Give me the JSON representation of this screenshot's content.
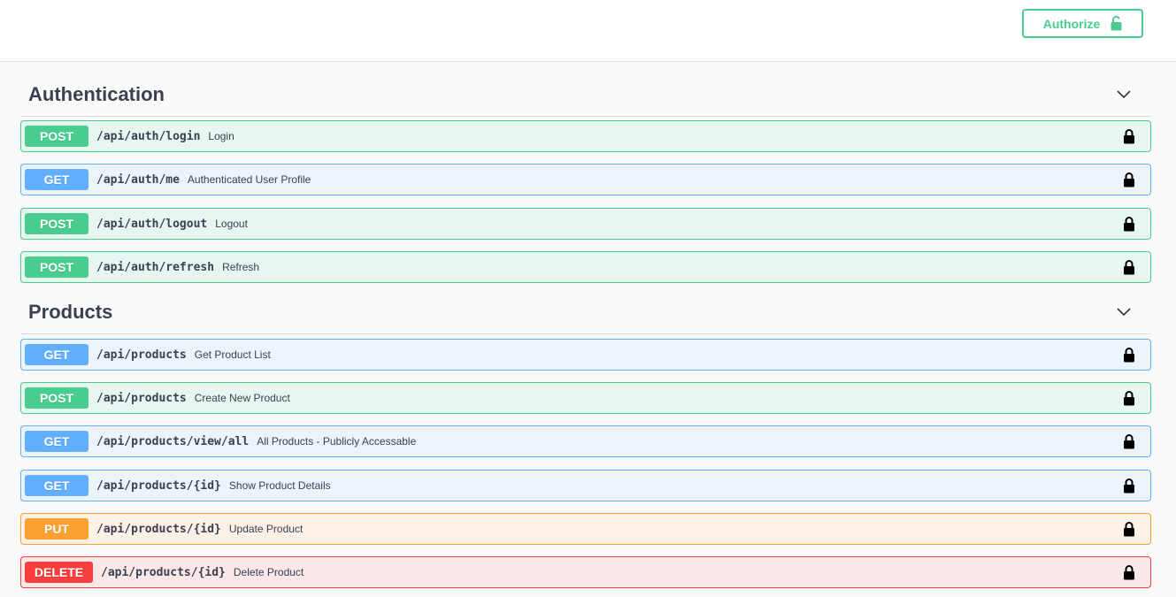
{
  "header": {
    "authorize_label": "Authorize",
    "authorize_icon": "unlocked-lock-icon"
  },
  "colors": {
    "post": "#49cc90",
    "get": "#61affe",
    "put": "#fca130",
    "delete": "#f93e3e"
  },
  "sections": [
    {
      "title": "Authentication",
      "operations": [
        {
          "method": "POST",
          "path": "/api/auth/login",
          "summary": "Login"
        },
        {
          "method": "GET",
          "path": "/api/auth/me",
          "summary": "Authenticated User Profile"
        },
        {
          "method": "POST",
          "path": "/api/auth/logout",
          "summary": "Logout"
        },
        {
          "method": "POST",
          "path": "/api/auth/refresh",
          "summary": "Refresh"
        }
      ]
    },
    {
      "title": "Products",
      "operations": [
        {
          "method": "GET",
          "path": "/api/products",
          "summary": "Get Product List"
        },
        {
          "method": "POST",
          "path": "/api/products",
          "summary": "Create New Product"
        },
        {
          "method": "GET",
          "path": "/api/products/view/all",
          "summary": "All Products - Publicly Accessable"
        },
        {
          "method": "GET",
          "path": "/api/products/{id}",
          "summary": "Show Product Details"
        },
        {
          "method": "PUT",
          "path": "/api/products/{id}",
          "summary": "Update Product"
        },
        {
          "method": "DELETE",
          "path": "/api/products/{id}",
          "summary": "Delete Product"
        }
      ]
    }
  ]
}
